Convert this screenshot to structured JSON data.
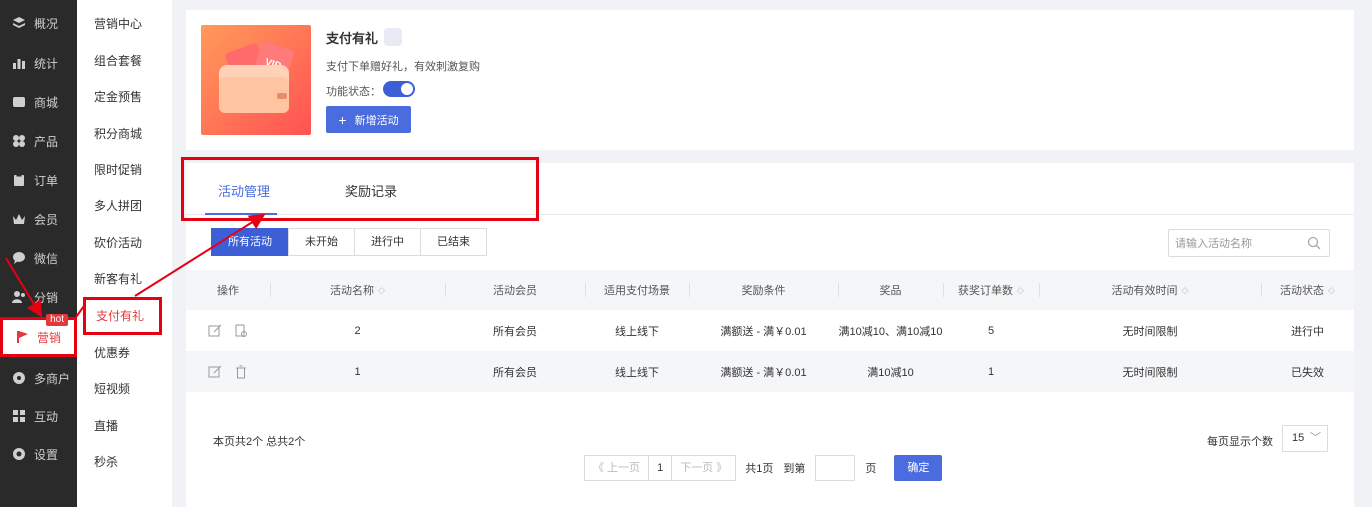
{
  "nav": {
    "items": [
      {
        "label": "概况",
        "icon": "layers-icon"
      },
      {
        "label": "统计",
        "icon": "chart-icon"
      },
      {
        "label": "商城",
        "icon": "store-icon"
      },
      {
        "label": "产品",
        "icon": "grid-icon"
      },
      {
        "label": "订单",
        "icon": "clipboard-icon"
      },
      {
        "label": "会员",
        "icon": "crown-icon"
      },
      {
        "label": "微信",
        "icon": "chat-icon"
      },
      {
        "label": "分销",
        "icon": "users-icon"
      },
      {
        "label": "营销",
        "icon": "flag-icon",
        "badge": "hot"
      },
      {
        "label": "多商户",
        "icon": "shop-icon"
      },
      {
        "label": "互动",
        "icon": "apps-icon"
      },
      {
        "label": "设置",
        "icon": "gear-icon"
      }
    ]
  },
  "subnav": {
    "items": [
      "营销中心",
      "组合套餐",
      "定金预售",
      "积分商城",
      "限时促销",
      "多人拼团",
      "砍价活动",
      "新客有礼",
      "支付有礼",
      "优惠券",
      "短视频",
      "直播",
      "秒杀"
    ]
  },
  "feature": {
    "title": "支付有礼",
    "cover_ticket": "VIP",
    "description": "支付下单赠好礼，有效刺激复购",
    "status_label": "功能状态：",
    "add_button": "新增活动",
    "add_icon": "+"
  },
  "tabs": [
    "活动管理",
    "奖励记录"
  ],
  "filters": [
    "所有活动",
    "未开始",
    "进行中",
    "已结束"
  ],
  "search": {
    "placeholder": "请输入活动名称"
  },
  "table": {
    "headers": [
      "操作",
      "活动名称",
      "活动会员",
      "适用支付场景",
      "奖励条件",
      "奖品",
      "获奖订单数",
      "活动有效时间",
      "活动状态"
    ],
    "rows": [
      {
        "name": "2",
        "member": "所有会员",
        "scene": "线上线下",
        "condition": "满额送 - 满￥0.01",
        "prize": "满10减10、满10减10",
        "orders": "5",
        "time": "无时间限制",
        "status": "进行中"
      },
      {
        "name": "1",
        "member": "所有会员",
        "scene": "线上线下",
        "condition": "满额送 - 满￥0.01",
        "prize": "满10减10",
        "orders": "1",
        "time": "无时间限制",
        "status": "已失效"
      }
    ]
  },
  "footer": {
    "count": "本页共2个  总共2个",
    "prev": "《 上一页",
    "page": "1",
    "next": "下一页 》",
    "total_pages": "共1页",
    "goto": "到第",
    "page_unit": "页",
    "confirm": "确定",
    "per_page_label": "每页显示个数",
    "per_page": "15"
  },
  "colors": {
    "accent": "#4a6cde",
    "highlight": "#e60012",
    "nav_bg": "#2a2a2a"
  }
}
